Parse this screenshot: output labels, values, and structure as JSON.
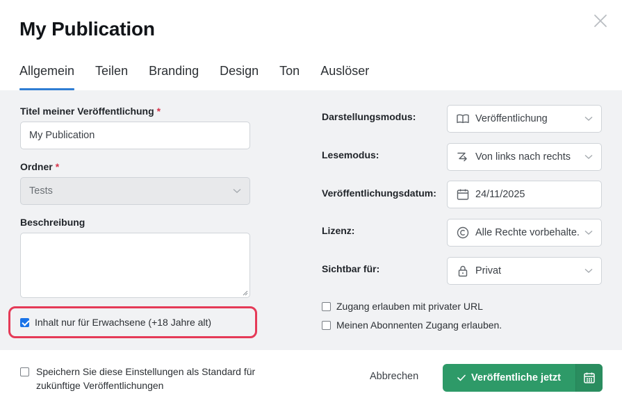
{
  "dialog": {
    "title": "My Publication"
  },
  "tabs": [
    {
      "label": "Allgemein",
      "active": true
    },
    {
      "label": "Teilen",
      "active": false
    },
    {
      "label": "Branding",
      "active": false
    },
    {
      "label": "Design",
      "active": false
    },
    {
      "label": "Ton",
      "active": false
    },
    {
      "label": "Auslöser",
      "active": false
    }
  ],
  "left": {
    "title_label": "Titel meiner Veröffentlichung",
    "title_value": "My Publication",
    "folder_label": "Ordner",
    "folder_value": "Tests",
    "description_label": "Beschreibung",
    "description_value": "",
    "required_mark": "*",
    "adult_content_label": "Inhalt nur für Erwachsene (+18 Jahre alt)",
    "adult_content_checked": true
  },
  "right": {
    "display_mode_label": "Darstellungsmodus:",
    "display_mode_value": "Veröffentlichung",
    "reading_mode_label": "Lesemodus:",
    "reading_mode_value": "Von links nach rechts",
    "publish_date_label": "Veröffentlichungsdatum:",
    "publish_date_value": "24/11/2025",
    "license_label": "Lizenz:",
    "license_value": "Alle Rechte vorbehalte...",
    "visibility_label": "Sichtbar für:",
    "visibility_value": "Privat",
    "private_url_label": "Zugang erlauben mit privater URL",
    "private_url_checked": false,
    "subscribers_label": "Meinen Abonnenten Zugang erlauben.",
    "subscribers_checked": false
  },
  "footer": {
    "save_default_label_line1": "Speichern Sie diese Einstellungen als Standard für",
    "save_default_label_line2": "zukünftige Veröffentlichungen",
    "save_default_checked": false,
    "cancel_label": "Abbrechen",
    "publish_label": "Veröffentliche jetzt"
  },
  "colors": {
    "accent_tab": "#2f7dd3",
    "publish_green": "#2e9a68",
    "highlight_red": "#e53a57",
    "required_red": "#d6334a",
    "body_bg": "#f1f2f4"
  }
}
